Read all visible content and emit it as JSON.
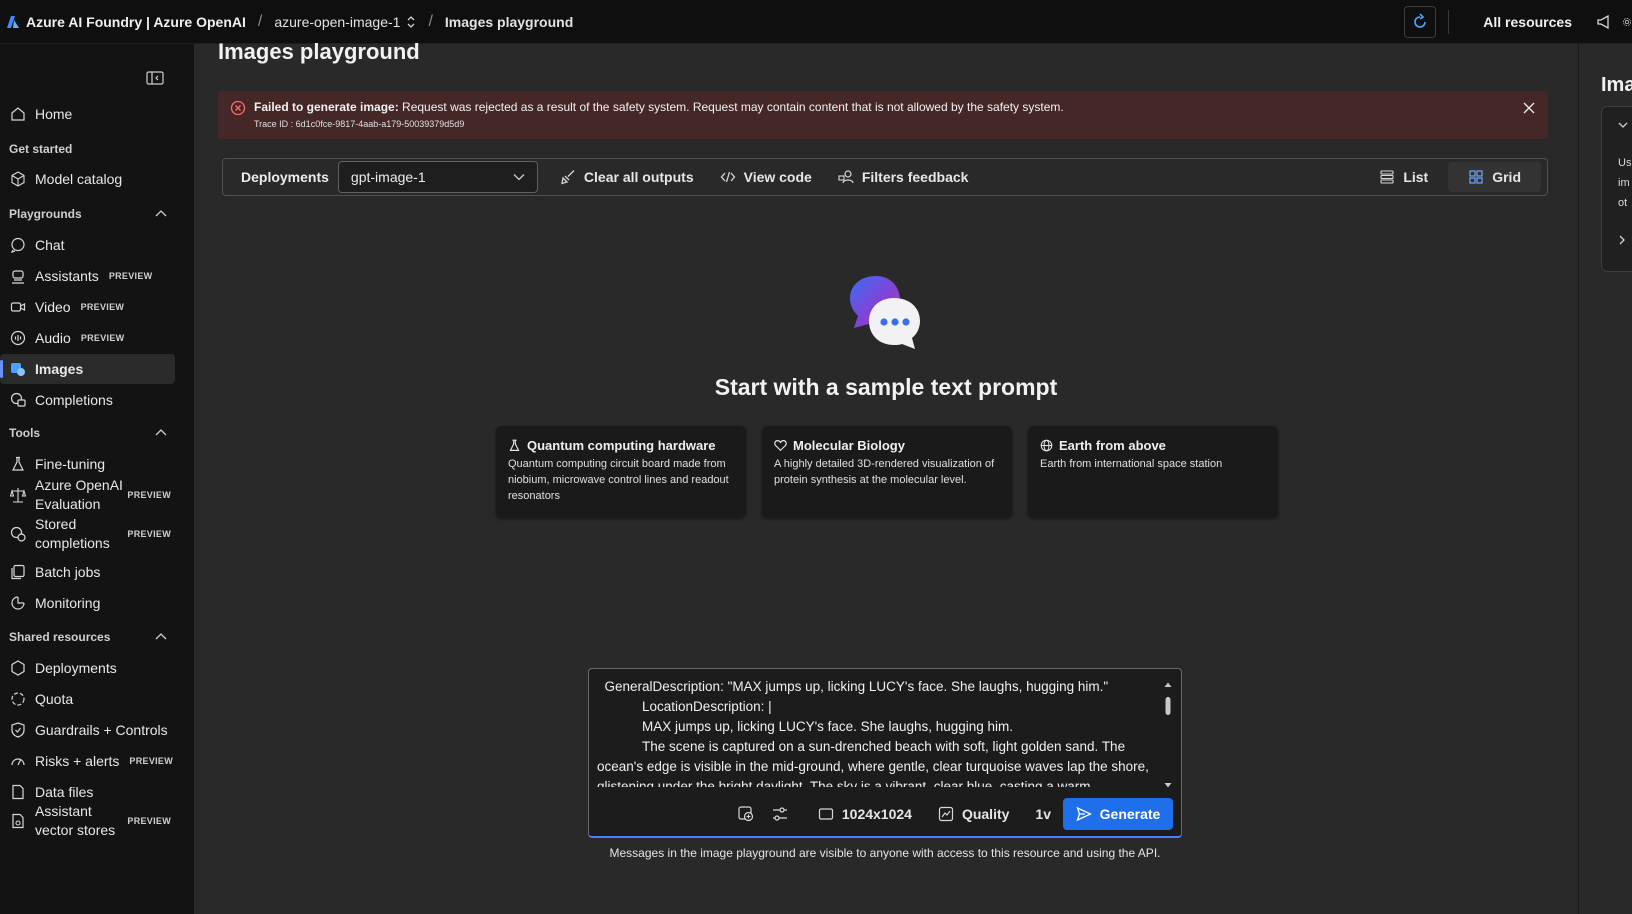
{
  "topbar": {
    "brand": "Azure AI Foundry | Azure OpenAI",
    "resource": "azure-open-image-1",
    "page": "Images playground",
    "all_resources": "All resources"
  },
  "sidebar": {
    "home": "Home",
    "sections": {
      "get_started": "Get started",
      "playgrounds": "Playgrounds",
      "tools": "Tools",
      "shared_resources": "Shared resources"
    },
    "items": {
      "model_catalog": "Model catalog",
      "chat": "Chat",
      "assistants": "Assistants",
      "video": "Video",
      "audio": "Audio",
      "images": "Images",
      "completions": "Completions",
      "fine_tuning": "Fine-tuning",
      "aoai_eval_1": "Azure OpenAI",
      "aoai_eval_2": "Evaluation",
      "stored_1": "Stored",
      "stored_2": "completions",
      "batch_jobs": "Batch jobs",
      "monitoring": "Monitoring",
      "deployments": "Deployments",
      "quota": "Quota",
      "guardrails": "Guardrails + Controls",
      "risks": "Risks + alerts",
      "data_files": "Data files",
      "vector_1": "Assistant",
      "vector_2": "vector stores"
    },
    "preview_badge": "PREVIEW"
  },
  "main": {
    "title": "Images playground",
    "error": {
      "label": "Failed to generate image:",
      "message": " Request was rejected as a result of the safety system. Request may contain content that is not allowed by the safety system.",
      "trace": "Trace ID : 6d1c0fce-9817-4aab-a179-50039379d5d9"
    },
    "toolbar": {
      "deployments_label": "Deployments",
      "deployment_value": "gpt-image-1",
      "clear_all": "Clear all outputs",
      "view_code": "View code",
      "filters_feedback": "Filters feedback",
      "list": "List",
      "grid": "Grid"
    },
    "hero_title": "Start with a sample text prompt",
    "cards": [
      {
        "icon": "flask-icon",
        "title": "Quantum computing hardware",
        "body": "Quantum computing circuit board made from niobium, microwave control lines and readout resonators"
      },
      {
        "icon": "heart-icon",
        "title": "Molecular Biology",
        "body": "A highly detailed 3D-rendered visualization of protein synthesis at the molecular level."
      },
      {
        "icon": "globe-icon",
        "title": "Earth from above",
        "body": "Earth from international space station"
      }
    ],
    "prompt": {
      "text": "  GeneralDescription: \"MAX jumps up, licking LUCY's face. She laughs, hugging him.\"\n            LocationDescription: |\n            MAX jumps up, licking LUCY's face. She laughs, hugging him.\n            The scene is captured on a sun-drenched beach with soft, light golden sand. The ocean's edge is visible in the mid-ground, where gentle, clear turquoise waves lap the shore, glistening under the bright daylight. The sky is a vibrant, clear blue, casting a warm",
      "size": "1024x1024",
      "quality": "Quality",
      "count": "1v",
      "generate": "Generate"
    },
    "footnote": "Messages in the image playground are visible to anyone with access to this resource and using the API."
  },
  "right_panel": {
    "title": "Ima",
    "lines": [
      "Us",
      "im",
      "ot"
    ]
  },
  "colors": {
    "accent": "#1f6feb",
    "error_bg": "#442726",
    "error_icon": "#ff6b6b"
  }
}
